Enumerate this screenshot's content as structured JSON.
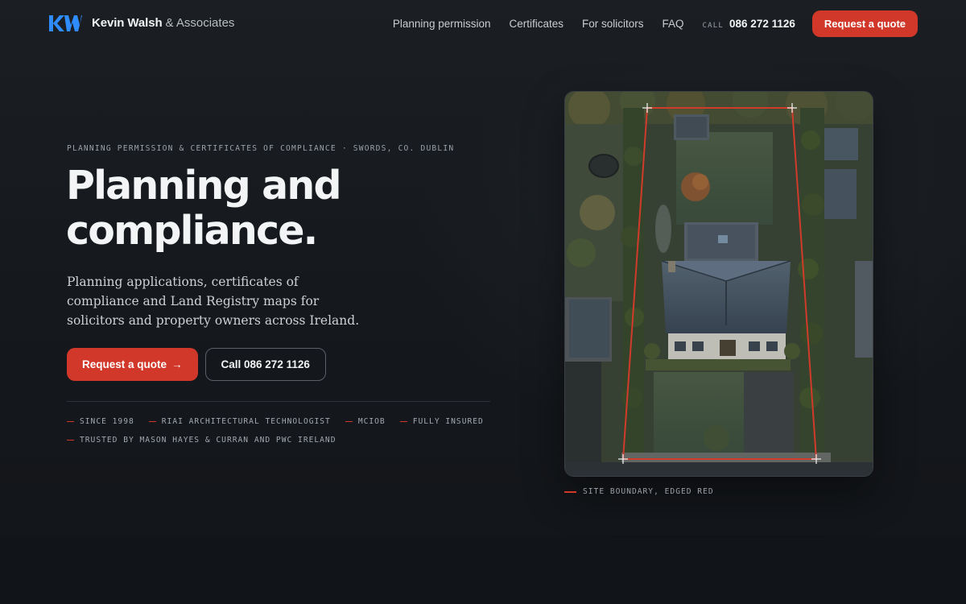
{
  "brand": {
    "name": "Kevin Walsh",
    "rest": "& Associates",
    "logo_color": "#2f8cff"
  },
  "nav": {
    "links": [
      "Planning permission",
      "Certificates",
      "For solicitors",
      "FAQ"
    ],
    "call_label": "CALL",
    "call_number": "086 272 1126",
    "quote_label": "Request a quote"
  },
  "hero": {
    "eyebrow": "PLANNING PERMISSION & CERTIFICATES OF COMPLIANCE · SWORDS, CO. DUBLIN",
    "headline_line1": "Planning and",
    "headline_line2": "compliance.",
    "lede": "Planning applications, certificates of compliance and Land Registry maps for solicitors and property owners across Ireland.",
    "primary_cta": "Request a quote",
    "primary_arrow": "→",
    "secondary_cta": "Call 086 272 1126",
    "badges": [
      "SINCE 1998",
      "RIAI ARCHITECTURAL TECHNOLOGIST",
      "MCIOB",
      "FULLY INSURED",
      "TRUSTED BY MASON HAYES & CURRAN AND PWC IRELAND"
    ]
  },
  "photo": {
    "caption": "SITE BOUNDARY, EDGED RED",
    "boundary_color": "#e2402e"
  },
  "colors": {
    "accent": "#d1382a",
    "background": "#121519"
  }
}
